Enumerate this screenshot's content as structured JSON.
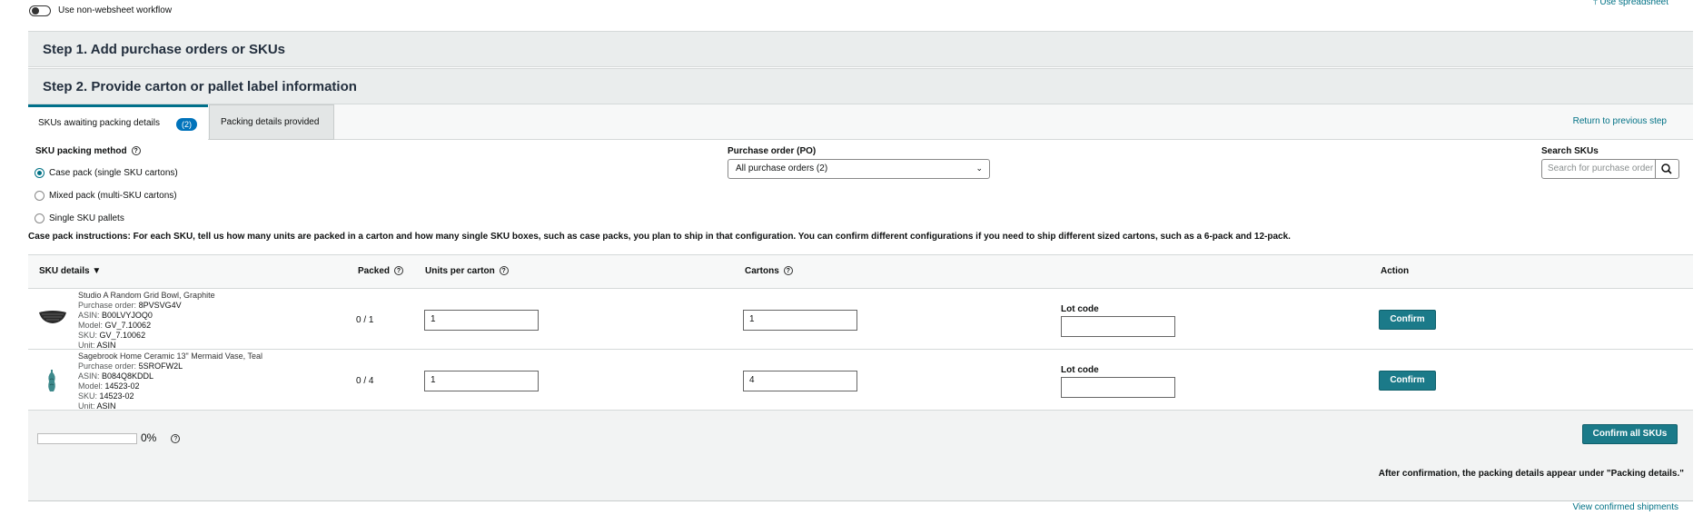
{
  "top": {
    "toggle_label": "Use non-websheet workflow",
    "use_spreadsheet": "Use spreadsheet"
  },
  "steps": {
    "step1": "Step 1. Add purchase orders or SKUs",
    "step2": "Step 2. Provide carton or pallet label information"
  },
  "tabs": {
    "awaiting": "SKUs awaiting packing details",
    "awaiting_count": "(2)",
    "provided": "Packing details provided",
    "return_link": "Return to previous step"
  },
  "filters": {
    "method_label": "SKU packing method",
    "methods": [
      {
        "label": "Case pack (single SKU cartons)",
        "selected": true
      },
      {
        "label": "Mixed pack (multi-SKU cartons)",
        "selected": false
      },
      {
        "label": "Single SKU pallets",
        "selected": false
      }
    ],
    "po_label": "Purchase order (PO)",
    "po_value": "All purchase orders (2)",
    "search_label": "Search SKUs",
    "search_placeholder": "Search for purchase order"
  },
  "instructions": "Case pack instructions: For each SKU, tell us how many units are packed in a carton and how many single SKU boxes, such as case packs, you plan to ship in that configuration. You can confirm different configurations if you need to ship different sized cartons, such as a 6-pack and 12-pack.",
  "table": {
    "headers": {
      "sku": "SKU details",
      "packed": "Packed",
      "units": "Units per carton",
      "cartons": "Cartons",
      "action": "Action"
    },
    "rows": [
      {
        "title": "Studio A Random Grid Bowl, Graphite",
        "po_label": "Purchase order:",
        "po": "8PVSVG4V",
        "asin_label": "ASIN:",
        "asin": "B00LVYJOQ0",
        "model_label": "Model:",
        "model": "GV_7.10062",
        "sku_label": "SKU:",
        "sku": "GV_7.10062",
        "unit_label": "Unit:",
        "unit": "ASIN",
        "packed": "0 / 1",
        "units_per_carton": "1",
        "cartons": "1",
        "lot_label": "Lot code",
        "lot_value": "",
        "confirm": "Confirm",
        "icon": "bowl-icon"
      },
      {
        "title": "Sagebrook Home Ceramic 13\" Mermaid Vase, Teal",
        "po_label": "Purchase order:",
        "po": "5SROFW2L",
        "asin_label": "ASIN:",
        "asin": "B084Q8KDDL",
        "model_label": "Model:",
        "model": "14523-02",
        "sku_label": "SKU:",
        "sku": "14523-02",
        "unit_label": "Unit:",
        "unit": "ASIN",
        "packed": "0 / 4",
        "units_per_carton": "1",
        "cartons": "4",
        "lot_label": "Lot code",
        "lot_value": "",
        "confirm": "Confirm",
        "icon": "vase-icon"
      }
    ]
  },
  "footer": {
    "progress": 0,
    "progress_text": "0%",
    "confirm_all": "Confirm all SKUs",
    "note": "After confirmation, the packing details appear under \"Packing details.\"",
    "view_link": "View confirmed shipments"
  },
  "colors": {
    "accent": "#007185",
    "button": "#1b7a89",
    "badge": "#0073bb",
    "step_bg": "#eaeded"
  }
}
